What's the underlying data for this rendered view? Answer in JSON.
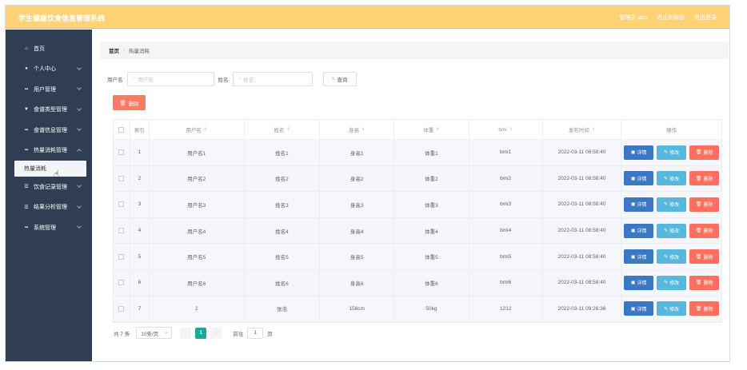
{
  "app": {
    "title": "学生健康饮食信息管理系统",
    "admin_label": "管理员 abo",
    "exit_admin": "退出到前台",
    "logout": "退出登录"
  },
  "sidebar": {
    "items": [
      {
        "icon": "home-icon",
        "glyph": "⌂",
        "label": "首页",
        "has_arrow": false
      },
      {
        "icon": "user-icon",
        "glyph": "●",
        "label": "个人中心",
        "has_arrow": true
      },
      {
        "icon": "grid-icon",
        "glyph": "▪▪",
        "label": "用户管理",
        "has_arrow": true
      },
      {
        "icon": "filter-icon",
        "glyph": "▼",
        "label": "食谱类型管理",
        "has_arrow": true
      },
      {
        "icon": "grid-icon",
        "glyph": "▪▪",
        "label": "食谱信息管理",
        "has_arrow": true
      },
      {
        "icon": "grid-icon",
        "glyph": "▪▪",
        "label": "热量消耗管理",
        "has_arrow": true,
        "sub": "热量消耗"
      },
      {
        "icon": "list-icon",
        "glyph": "☰",
        "label": "饮食记录管理",
        "has_arrow": true
      },
      {
        "icon": "list-icon",
        "glyph": "☰",
        "label": "结果分析管理",
        "has_arrow": true
      },
      {
        "icon": "grid-icon",
        "glyph": "▪▪",
        "label": "系统管理",
        "has_arrow": true
      }
    ]
  },
  "breadcrumb": {
    "home": "首页",
    "separator": "/",
    "current": "热量消耗"
  },
  "filter": {
    "username_label": "用户名",
    "username_placeholder": "用户名",
    "name_label": "姓名",
    "name_placeholder": "姓名",
    "search_button": "查询"
  },
  "toolbar": {
    "delete_button": "删除"
  },
  "table": {
    "headers": [
      "索引",
      "用户名",
      "姓名",
      "身高",
      "体重",
      "bmi",
      "发布时间",
      "操作"
    ],
    "rows": [
      {
        "idx": "1",
        "username": "用户名1",
        "name": "姓名1",
        "height": "身高1",
        "weight": "体重1",
        "bmi": "bmi1",
        "time": "2022-03-11 08:58:40"
      },
      {
        "idx": "2",
        "username": "用户名2",
        "name": "姓名2",
        "height": "身高2",
        "weight": "体重2",
        "bmi": "bmi2",
        "time": "2022-03-11 08:58:40"
      },
      {
        "idx": "3",
        "username": "用户名3",
        "name": "姓名3",
        "height": "身高3",
        "weight": "体重3",
        "bmi": "bmi3",
        "time": "2022-03-11 08:58:40"
      },
      {
        "idx": "4",
        "username": "用户名4",
        "name": "姓名4",
        "height": "身高4",
        "weight": "体重4",
        "bmi": "bmi4",
        "time": "2022-03-11 08:58:40"
      },
      {
        "idx": "5",
        "username": "用户名5",
        "name": "姓名5",
        "height": "身高5",
        "weight": "体重5",
        "bmi": "bmi5",
        "time": "2022-03-11 08:58:40"
      },
      {
        "idx": "6",
        "username": "用户名6",
        "name": "姓名6",
        "height": "身高6",
        "weight": "体重6",
        "bmi": "bmi6",
        "time": "2022-03-11 08:58:40"
      },
      {
        "idx": "7",
        "username": "2",
        "name": "张浩",
        "height": "158cm",
        "weight": "50kg",
        "bmi": "1212",
        "time": "2022-03-11 09:26:36"
      }
    ],
    "actions": {
      "detail": "详情",
      "edit": "修改",
      "delete": "删除"
    }
  },
  "pagination": {
    "total": "共 7 条",
    "page_size": "10条/页",
    "prev": "‹",
    "current_page": "1",
    "next": "›",
    "goto_label": "前往",
    "goto_value": "1",
    "page_suffix": "页"
  },
  "colors": {
    "topbar": "#ffd275",
    "sidebar": "#2f3e53",
    "danger": "#ff7a63",
    "detail": "#3a78c3",
    "edit": "#58b7dc",
    "active_page": "#1aa89a"
  }
}
